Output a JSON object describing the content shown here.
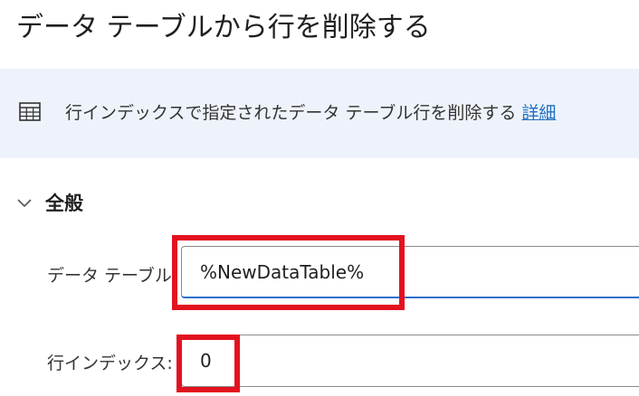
{
  "dialog": {
    "title": "データ テーブルから行を削除する"
  },
  "info": {
    "icon": "table-icon",
    "description": "行インデックスで指定されたデータ テーブル行を削除する",
    "details_link": "詳細"
  },
  "general_section": {
    "icon": "chevron-down-icon",
    "title": "全般",
    "expanded": true
  },
  "fields": {
    "data_table": {
      "label": "データ テーブル:",
      "value": "%NewDataTable%"
    },
    "row_index": {
      "label": "行インデックス:",
      "value": "0"
    }
  },
  "colors": {
    "banner_background": "#eef3fb",
    "link": "#1f6fc5",
    "focus_underline": "#2b6fc8",
    "highlight": "#e3121f"
  }
}
